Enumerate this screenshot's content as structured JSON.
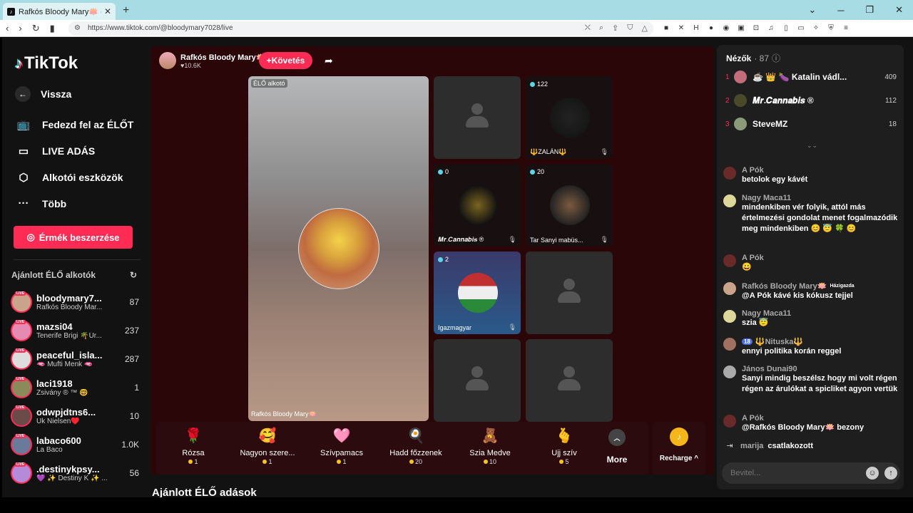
{
  "browser": {
    "tab_title": "Rafkós Bloody Mary🪷 (@blo",
    "url": "https://www.tiktok.com/@bloodymary7028/live",
    "colors": {
      "tabbar": "#a8dce4",
      "accent": "#fe2c55"
    }
  },
  "sidebar": {
    "logo": "TikTok",
    "back": "Vissza",
    "nav": [
      {
        "label": "Fedezd fel az ÉLŐT",
        "icon": "live-tv-icon"
      },
      {
        "label": "LIVE ADÁS",
        "icon": "camera-icon"
      },
      {
        "label": "Alkotói eszközök",
        "icon": "creator-tools-icon"
      },
      {
        "label": "Több",
        "icon": "more-dots-icon"
      }
    ],
    "coins_button": "Érmék beszerzése",
    "recommended_title": "Ajánlott ÉLŐ alkotók",
    "live_badge": "LIVE",
    "recommended": [
      {
        "name": "bloodymary7...",
        "sub": "Rafkós Bloody Mar...",
        "count": "87",
        "color": "#c9a38a"
      },
      {
        "name": "mazsi04",
        "sub": "Tenerife Brigi 🌴Úr...",
        "count": "237",
        "color": "#e58ab0"
      },
      {
        "name": "peaceful_isla...",
        "sub": "🫦 Mufti Menk 🫦",
        "count": "287",
        "color": "#ddd"
      },
      {
        "name": "laci1918",
        "sub": "Zsivány ® ™ 🤓",
        "count": "1",
        "color": "#8a8a5a"
      },
      {
        "name": "odwpjdtns6...",
        "sub": "Uk Nielsen♥️",
        "count": "10",
        "color": "#6b4a4a"
      },
      {
        "name": "labaco600",
        "sub": "La Baco",
        "count": "1.0K",
        "color": "#6a7a9a"
      },
      {
        "name": ".destinykpsy...",
        "sub": "💜 ✨ Destiny K ✨ ...",
        "count": "56",
        "color": "#b58ad8"
      }
    ]
  },
  "stage": {
    "host_name": "Rafkós Bloody Mary🪷",
    "host_likes": "♥10.6K",
    "follow_label": "+Követés",
    "main_tag": "ÉLŐ alkotó",
    "main_caption": "Rafkós Bloody Mary🪷",
    "slots": [
      {
        "name": "",
        "count": ""
      },
      {
        "name": "🔱ZALÁN🔱",
        "count": "122"
      },
      {
        "name": "𝑴𝒓.𝑪𝒂𝒏𝒏𝒂𝒃𝒊𝒔 ®",
        "count": "0"
      },
      {
        "name": "Tar Sanyi mabüs...",
        "count": "20"
      },
      {
        "name": "Igazmagyar",
        "count": "2"
      },
      {
        "name": "",
        "count": ""
      },
      {
        "name": "",
        "count": ""
      },
      {
        "name": "",
        "count": ""
      }
    ],
    "gifts": [
      {
        "name": "Rózsa",
        "price": "1",
        "icon": "🌹"
      },
      {
        "name": "Nagyon szere...",
        "price": "1",
        "icon": "🥰"
      },
      {
        "name": "Szívpamacs",
        "price": "1",
        "icon": "🩷"
      },
      {
        "name": "Hadd főzzenek",
        "price": "20",
        "icon": "🍳"
      },
      {
        "name": "Szia Medve",
        "price": "10",
        "icon": "🧸"
      },
      {
        "name": "Ujj szív",
        "price": "5",
        "icon": "🫰"
      }
    ],
    "more_label": "More",
    "recharge_label": "Recharge ^",
    "suggested_title": "Ajánlott ÉLŐ adások"
  },
  "viewers": {
    "title": "Nézők",
    "count": "· 87",
    "top": [
      {
        "rank": "1",
        "name": "☕ 👑 🍆 Katalin vádl...",
        "score": "409",
        "color": "#c46d7a"
      },
      {
        "rank": "2",
        "name": "𝑴𝒓.𝑪𝒂𝒏𝒏𝒂𝒃𝒊𝒔 ®",
        "score": "112",
        "color": "#4a4a2a"
      },
      {
        "rank": "3",
        "name": "SteveMZ",
        "score": "18",
        "color": "#8a9a7a"
      }
    ]
  },
  "chat": {
    "messages": [
      {
        "user": "A Pók",
        "text": "betolok egy kávét",
        "color": "#6a2a2a"
      },
      {
        "user": "Nagy Maca11",
        "text": "mindenkiben vér folyik, attól más értelmezési gondolat menet fogalmazódik meg mindenkiben 😊 😇 🍀 😊",
        "color": "#ddd89a"
      },
      {
        "user": "A Pók",
        "text": "😀",
        "color": "#6a2a2a"
      },
      {
        "user": "Rafkós Bloody Mary🪷",
        "text": "@A Pók kávé kis kókusz tejjel",
        "badge": "Házigazda",
        "color": "#c9a38a"
      },
      {
        "user": "Nagy Maca11",
        "text": "szia 😇",
        "color": "#ddd89a"
      },
      {
        "user": "🔱Nituska🔱",
        "text": "ennyi politika korán reggel",
        "level": "18",
        "color": "#a07060"
      },
      {
        "user": "János Dunai90",
        "text": "Sanyi mindig beszélsz hogy mi volt régen régen az árulókat a spicliket agyon vertük",
        "color": "#aaa"
      },
      {
        "user": "A Pók",
        "text": "@Rafkós Bloody Mary🪷 bezony",
        "color": "#6a2a2a"
      }
    ],
    "joined_user": "marija",
    "joined_text": "csatlakozott",
    "input_placeholder": "Bevitel..."
  }
}
